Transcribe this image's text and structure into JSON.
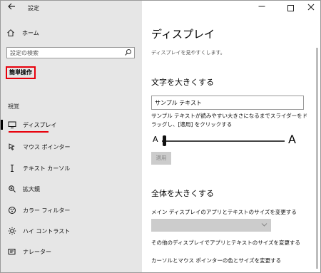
{
  "window": {
    "title": "設定",
    "back_icon": "arrow-left-icon",
    "controls": {
      "minimize": "—",
      "maximize": "",
      "close": "✕"
    }
  },
  "sidebar": {
    "home_label": "ホーム",
    "search_placeholder": "設定の検索",
    "section_label": "簡単操作",
    "group_label": "視覚",
    "items": [
      {
        "label": "ディスプレイ",
        "icon": "monitor-icon",
        "active": true
      },
      {
        "label": "マウス ポインター",
        "icon": "mouse-pointer-icon",
        "active": false
      },
      {
        "label": "テキスト カーソル",
        "icon": "text-cursor-icon",
        "active": false
      },
      {
        "label": "拡大鏡",
        "icon": "magnifier-icon",
        "active": false
      },
      {
        "label": "カラー フィルター",
        "icon": "color-filter-icon",
        "active": false
      },
      {
        "label": "ハイ コントラスト",
        "icon": "high-contrast-icon",
        "active": false
      },
      {
        "label": "ナレーター",
        "icon": "narrator-icon",
        "active": false
      }
    ],
    "accent_color": "#e8000b"
  },
  "main": {
    "title": "ディスプレイ",
    "description": "ディスプレイを見やすくします。",
    "text_size": {
      "heading": "文字を大きくする",
      "sample_text": "サンプル テキスト",
      "instruction": "サンプル テキストが読みやすい大きさになるまでスライダーをドラッグし、[適用] をクリックする",
      "small_a": "A",
      "large_a": "A",
      "slider_value_fraction": 0.0,
      "apply_label": "適用"
    },
    "make_everything_bigger": {
      "heading": "全体を大きくする",
      "dropdown_label": "メイン ディスプレイのアプリとテキストのサイズを変更する",
      "dropdown_value": "",
      "link_other_displays": "その他のディスプレイでアプリとテキストのサイズを変更する",
      "link_cursor_pointer": "カーソルとマウス ポインターの色とサイズを変更する"
    }
  }
}
